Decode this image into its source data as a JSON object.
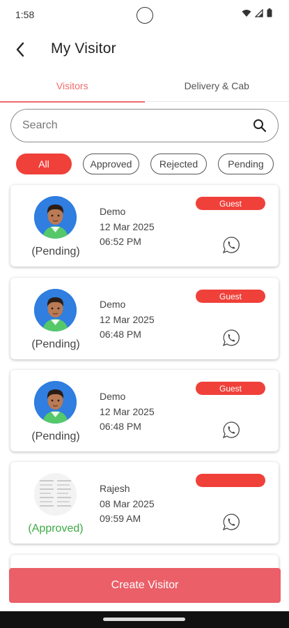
{
  "status_bar": {
    "time": "1:58"
  },
  "header": {
    "title": "My Visitor"
  },
  "tabs": [
    {
      "label": "Visitors",
      "active": true
    },
    {
      "label": "Delivery & Cab",
      "active": false
    }
  ],
  "search": {
    "placeholder": "Search",
    "value": ""
  },
  "filters": [
    {
      "label": "All",
      "active": true
    },
    {
      "label": "Approved",
      "active": false
    },
    {
      "label": "Rejected",
      "active": false
    },
    {
      "label": "Pending",
      "active": false
    }
  ],
  "visitors": [
    {
      "name": "Demo",
      "date": "12 Mar 2025",
      "time": "06:52 PM",
      "status": "(Pending)",
      "type": "Guest",
      "avatar": "person-avatar"
    },
    {
      "name": "Demo",
      "date": "12 Mar 2025",
      "time": "06:48 PM",
      "status": "(Pending)",
      "type": "Guest",
      "avatar": "person-avatar"
    },
    {
      "name": "Demo",
      "date": "12 Mar 2025",
      "time": "06:48 PM",
      "status": "(Pending)",
      "type": "Guest",
      "avatar": "person-avatar"
    },
    {
      "name": "Rajesh",
      "date": "08 Mar 2025",
      "time": "09:59 AM",
      "status": "(Approved)",
      "type": "",
      "avatar": "document-thumbnail"
    }
  ],
  "create_button": {
    "label": "Create Visitor"
  },
  "colors": {
    "accent": "#f0403a",
    "tab_active": "#ef6b6b",
    "approved": "#3daa44",
    "create_button": "#ea5f68"
  },
  "icons": [
    "back-arrow-icon",
    "search-icon",
    "whatsapp-icon",
    "wifi-icon",
    "signal-icon",
    "battery-icon"
  ]
}
